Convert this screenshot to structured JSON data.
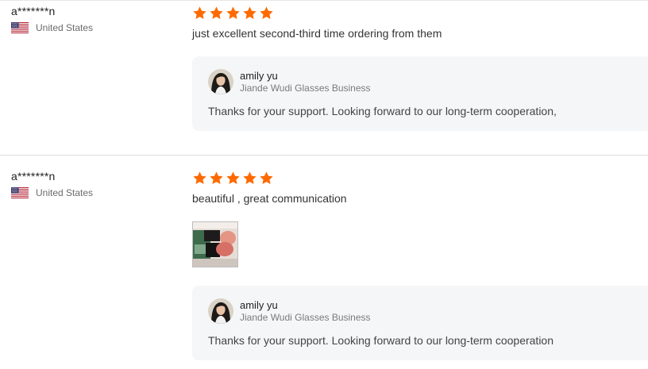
{
  "colors": {
    "star": "#ff6a00",
    "reply_background": "#f5f6f7",
    "divider": "#dcdcdc"
  },
  "reviews": [
    {
      "buyer": "a*******n",
      "country": "United States",
      "flag_icon": "us-flag-icon",
      "rating": 5,
      "comment": "just excellent second-third time ordering from them",
      "reply": {
        "seller": "amily yu",
        "company": "Jiande Wudi Glasses Business",
        "text": "Thanks for your support. Looking forward to our long-term cooperation,"
      }
    },
    {
      "buyer": "a*******n",
      "country": "United States",
      "flag_icon": "us-flag-icon",
      "rating": 5,
      "comment": "beautiful , great communication",
      "photo_icon": "product-photo-thumbnail",
      "reply": {
        "seller": "amily yu",
        "company": "Jiande Wudi Glasses Business",
        "text": "Thanks for your support. Looking forward to our long-term cooperation"
      }
    }
  ]
}
